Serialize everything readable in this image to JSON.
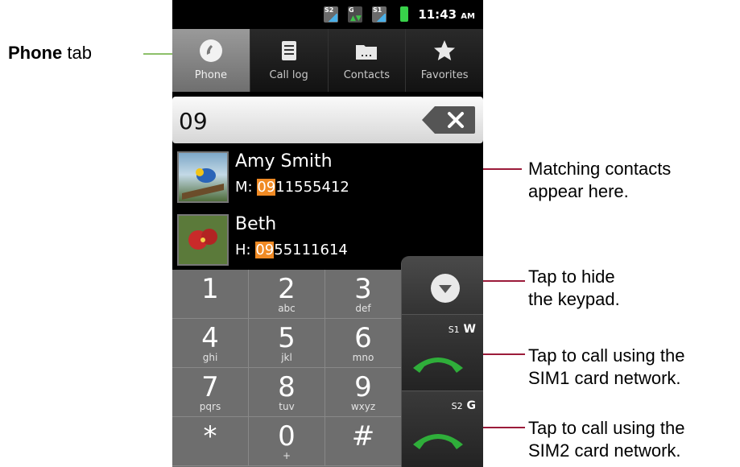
{
  "status_bar": {
    "sim2_tag": "S2",
    "data_tag": "G",
    "sim1_tag": "S1",
    "time": "11:43",
    "ampm": "AM"
  },
  "tabs": [
    {
      "label": "Phone",
      "icon": "phone-icon",
      "active": true
    },
    {
      "label": "Call log",
      "icon": "call-log-icon",
      "active": false
    },
    {
      "label": "Contacts",
      "icon": "contacts-icon",
      "active": false
    },
    {
      "label": "Favorites",
      "icon": "star-icon",
      "active": false
    }
  ],
  "dial_input": {
    "value": "09"
  },
  "contacts": [
    {
      "name": "Amy Smith",
      "type": "M:",
      "match": "09",
      "rest": "11555412"
    },
    {
      "name": "Beth",
      "type": "H:",
      "match": "09",
      "rest": "55111614"
    }
  ],
  "keys": [
    {
      "digit": "1",
      "letters": ""
    },
    {
      "digit": "2",
      "letters": "abc"
    },
    {
      "digit": "3",
      "letters": "def"
    },
    {
      "digit": "4",
      "letters": "ghi"
    },
    {
      "digit": "5",
      "letters": "jkl"
    },
    {
      "digit": "6",
      "letters": "mno"
    },
    {
      "digit": "7",
      "letters": "pqrs"
    },
    {
      "digit": "8",
      "letters": "tuv"
    },
    {
      "digit": "9",
      "letters": "wxyz"
    },
    {
      "digit": "*",
      "letters": ""
    },
    {
      "digit": "0",
      "letters": "+"
    },
    {
      "digit": "#",
      "letters": ""
    }
  ],
  "call_buttons": [
    {
      "sim": "S1",
      "network": "W"
    },
    {
      "sim": "S2",
      "network": "G"
    }
  ],
  "callouts": {
    "phone_tab_bold": "Phone",
    "phone_tab_rest": " tab",
    "matching_1": "Matching contacts",
    "matching_2": "appear here.",
    "hide_1": "Tap to hide",
    "hide_2": "the keypad.",
    "sim1_1": "Tap to call using the",
    "sim1_2": "SIM1 card network.",
    "sim2_1": "Tap to call using the",
    "sim2_2": "SIM2 card network."
  },
  "colors": {
    "highlight": "#f08a24",
    "call_green": "#2fae3a",
    "callout_green": "#8dc06a",
    "callout_red": "#9b1b3a"
  }
}
